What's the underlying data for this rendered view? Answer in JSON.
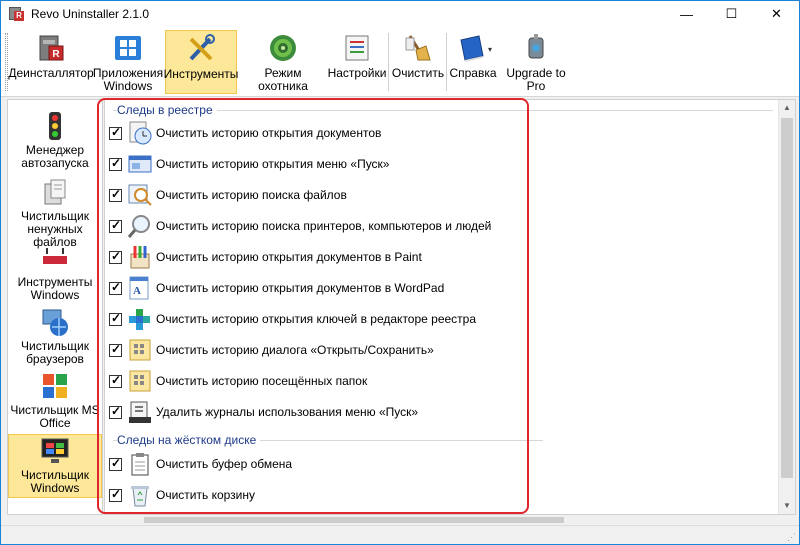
{
  "window": {
    "title": "Revo Uninstaller 2.1.0"
  },
  "toolbar": {
    "uninstaller": "Деинсталлятор",
    "windows_apps": "Приложения Windows",
    "tools": "Инструменты",
    "hunter_mode": "Режим охотника",
    "settings": "Настройки",
    "clean": "Очистить",
    "help": "Справка",
    "upgrade": "Upgrade to Pro"
  },
  "sidebar": {
    "items": [
      {
        "label": "Менеджер автозапуска"
      },
      {
        "label": "Чистильщик ненужных файлов"
      },
      {
        "label": "Инструменты Windows"
      },
      {
        "label": "Чистильщик браузеров"
      },
      {
        "label": "Чистильщик MS Office"
      },
      {
        "label": "Чистильщик Windows"
      }
    ]
  },
  "main": {
    "group_registry": "Следы в реестре",
    "group_disk": "Следы на жёстком диске",
    "registry_items": [
      {
        "label": "Очистить историю открытия документов",
        "checked": true
      },
      {
        "label": "Очистить историю открытия меню «Пуск»",
        "checked": true
      },
      {
        "label": "Очистить историю поиска файлов",
        "checked": true
      },
      {
        "label": "Очистить историю поиска принтеров, компьютеров и людей",
        "checked": true
      },
      {
        "label": "Очистить историю открытия документов в Paint",
        "checked": true
      },
      {
        "label": "Очистить историю открытия документов в WordPad",
        "checked": true
      },
      {
        "label": "Очистить историю открытия ключей в редакторе реестра",
        "checked": true
      },
      {
        "label": "Очистить историю диалога «Открыть/Сохранить»",
        "checked": true
      },
      {
        "label": "Очистить историю посещённых папок",
        "checked": true
      },
      {
        "label": "Удалить журналы использования меню «Пуск»",
        "checked": true
      }
    ],
    "disk_items": [
      {
        "label": "Очистить буфер обмена",
        "checked": true
      },
      {
        "label": "Очистить корзину",
        "checked": true
      }
    ]
  },
  "colors": {
    "accent_highlight": "#e0262a",
    "active_bg": "#fde89a",
    "group_label": "#1d3a8a"
  }
}
